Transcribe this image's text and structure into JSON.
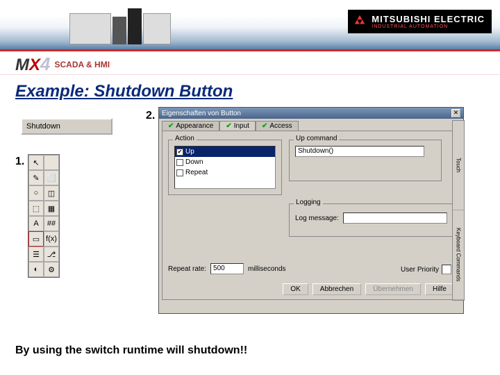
{
  "brand": {
    "name": "MITSUBISHI ELECTRIC",
    "sub": "INDUSTRIAL AUTOMATION"
  },
  "product": {
    "scada": "SCADA & HMI"
  },
  "slide_title": "Example: Shutdown Button",
  "shutdown_button_label": "Shutdown",
  "callouts": {
    "one": "1.",
    "two": "2."
  },
  "toolbox": {
    "tools": [
      "↖",
      "",
      "✎",
      "⬜",
      "○",
      "◫",
      "⬚",
      "▦",
      "A",
      "##",
      "▭",
      "f(x)",
      "☰",
      "⎇",
      "◐",
      "⚙"
    ]
  },
  "dialog": {
    "title": "Eigenschaften von Button",
    "tabs": [
      "Appearance",
      "Input",
      "Access"
    ],
    "active_tab": "Input",
    "action": {
      "label": "Action",
      "items": [
        {
          "label": "Up",
          "checked": true,
          "selected": true
        },
        {
          "label": "Down",
          "checked": false,
          "selected": false
        },
        {
          "label": "Repeat",
          "checked": false,
          "selected": false
        }
      ]
    },
    "up_command": {
      "label": "Up command",
      "value": "Shutdown()"
    },
    "logging": {
      "label": "Logging",
      "msg_label": "Log message:",
      "value": ""
    },
    "repeat": {
      "label": "Repeat rate:",
      "value": "500",
      "unit": "milliseconds"
    },
    "priority_label": "User Priority",
    "buttons": {
      "ok": "OK",
      "cancel": "Abbrechen",
      "apply": "Übernehmen",
      "help": "Hilfe"
    }
  },
  "sidebar": {
    "items": [
      "Touch",
      "Keyboard Commands"
    ]
  },
  "footer": "By using the switch runtime will shutdown!!"
}
